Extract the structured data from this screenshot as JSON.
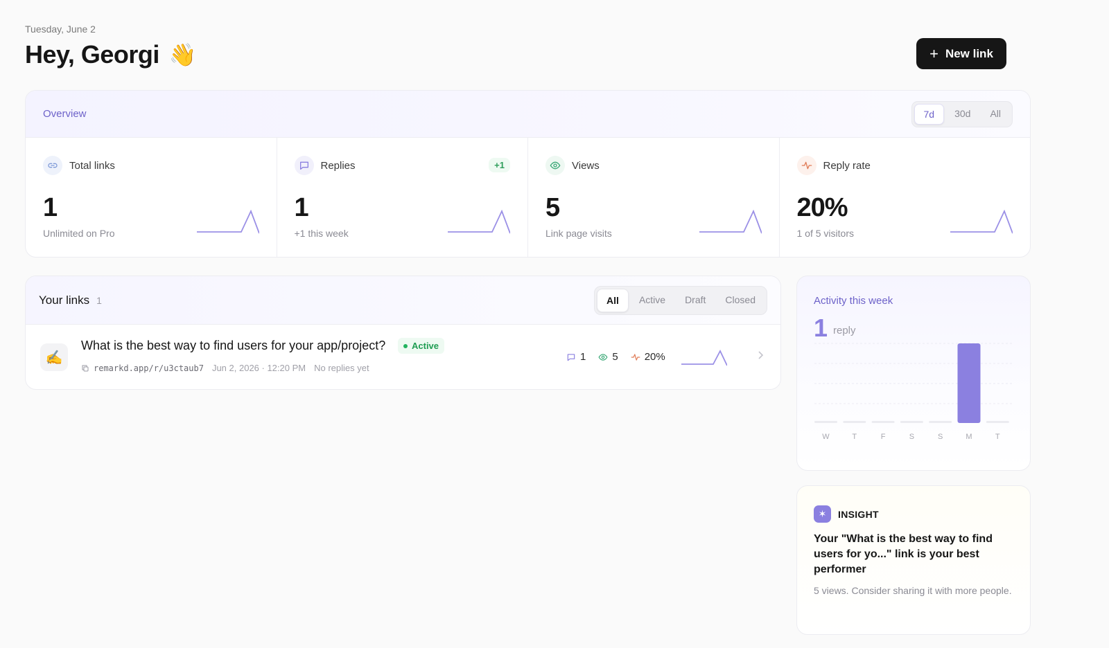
{
  "header": {
    "date": "Tuesday, June 2",
    "greeting": "Hey, Georgi",
    "wave_emoji": "👋",
    "new_link_label": "New link"
  },
  "overview": {
    "title": "Overview",
    "ranges": [
      "7d",
      "30d",
      "All"
    ],
    "active_range": "7d",
    "stats": [
      {
        "icon": "link-icon",
        "label": "Total links",
        "value": "1",
        "sub": "Unlimited on Pro",
        "badge": ""
      },
      {
        "icon": "chat-icon",
        "label": "Replies",
        "value": "1",
        "sub": "+1 this week",
        "badge": "+1"
      },
      {
        "icon": "eye-icon",
        "label": "Views",
        "value": "5",
        "sub": "Link page visits",
        "badge": ""
      },
      {
        "icon": "pulse-icon",
        "label": "Reply rate",
        "value": "20%",
        "sub": "1 of 5 visitors",
        "badge": ""
      }
    ]
  },
  "links": {
    "title": "Your links",
    "count": "1",
    "filters": [
      "All",
      "Active",
      "Draft",
      "Closed"
    ],
    "active_filter": "All",
    "items": [
      {
        "emoji": "✍️",
        "title": "What is the best way to find users for your app/project?",
        "status": "Active",
        "url": "remarkd.app/r/u3ctaub7",
        "created": "Jun 2, 2026 · 12:20 PM",
        "replies_note": "No replies yet",
        "replies": "1",
        "views": "5",
        "rate": "20%"
      }
    ]
  },
  "activity": {
    "title": "Activity this week",
    "count": "1",
    "unit": "reply",
    "days": [
      "W",
      "T",
      "F",
      "S",
      "S",
      "M",
      "T"
    ],
    "values": [
      0,
      0,
      0,
      0,
      0,
      1,
      0
    ]
  },
  "insight": {
    "label": "INSIGHT",
    "icon": "sparkle-icon",
    "text": "Your \"What is the best way to find users for yo...\" link is your best performer",
    "sub": "5 views. Consider sharing it with more people."
  },
  "colors": {
    "accent": "#8b80e0",
    "accent_text": "#6d62c9",
    "active_green": "#1f9d52",
    "button_dark": "#161616"
  }
}
